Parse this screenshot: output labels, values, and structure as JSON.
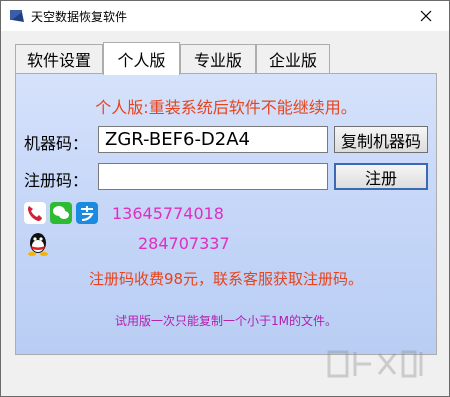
{
  "window": {
    "title": "天空数据恢复软件"
  },
  "tabs": [
    {
      "label": "软件设置"
    },
    {
      "label": "个人版"
    },
    {
      "label": "专业版"
    },
    {
      "label": "企业版"
    }
  ],
  "panel": {
    "notice": "个人版:重装系统后软件不能继续用。",
    "machine_code_label": "机器码：",
    "machine_code_value": "ZGR-BEF6-D2A4",
    "copy_button": "复制机器码",
    "reg_code_label": "注册码：",
    "reg_code_value": "",
    "register_button": "注册",
    "phone": "13645774018",
    "qq": "284707337",
    "fee_text": "注册码收费98元，联系客服获取注册码。",
    "trial_text": "试用版一次只能复制一个小于1M的文件。"
  },
  "colors": {
    "notice": "#e8431c",
    "contact": "#e02ec0",
    "trial": "#b21fae"
  }
}
